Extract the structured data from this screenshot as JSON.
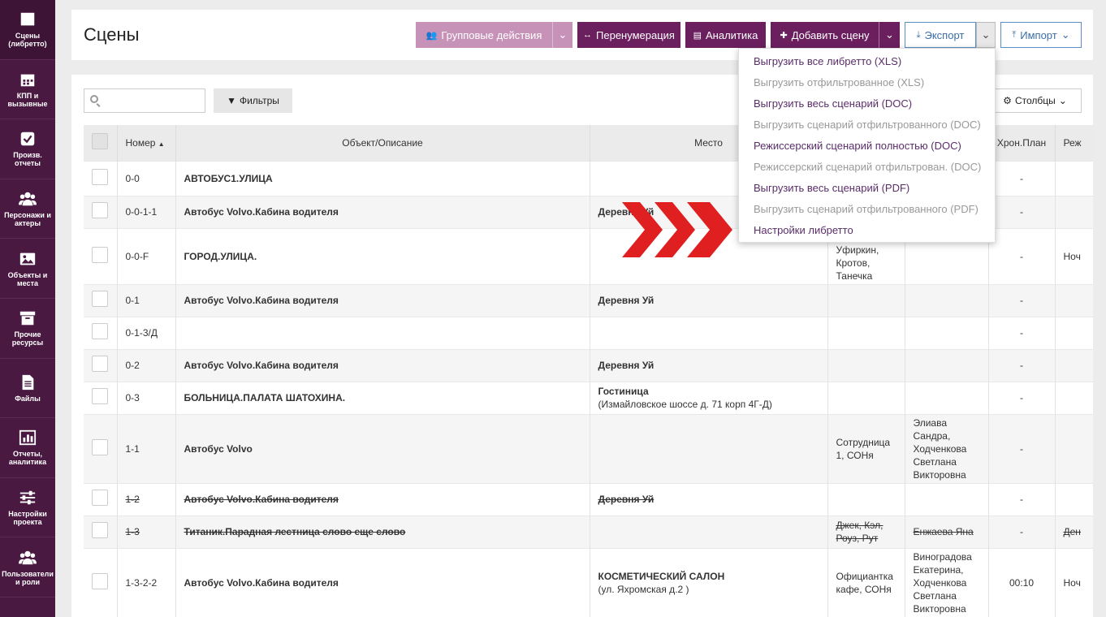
{
  "sidebar": {
    "items": [
      {
        "label": "Сцены (либретто)",
        "icon": "clapperboard-icon"
      },
      {
        "label": "КПП и вызывные",
        "icon": "calendar-icon"
      },
      {
        "label": "Произв. отчеты",
        "icon": "checkbox-icon"
      },
      {
        "label": "Персонажи и актеры",
        "icon": "users-icon"
      },
      {
        "label": "Объекты и места",
        "icon": "image-icon"
      },
      {
        "label": "Прочие ресурсы",
        "icon": "archive-icon"
      },
      {
        "label": "Файлы",
        "icon": "file-icon"
      },
      {
        "label": "Отчеты, аналитика",
        "icon": "bar-chart-icon"
      },
      {
        "label": "Настройки проекта",
        "icon": "sliders-icon"
      },
      {
        "label": "Пользователи и роли",
        "icon": "users-icon"
      }
    ]
  },
  "header": {
    "title": "Сцены",
    "group_actions": "Групповые действия",
    "renumber": "Перенумерация",
    "analytics": "Аналитика",
    "add_scene": "Добавить сцену",
    "export": "Экспорт",
    "import": "Импорт"
  },
  "toolbar": {
    "search_placeholder": "",
    "filters": "Фильтры",
    "columns": "Столбцы"
  },
  "export_menu": [
    {
      "label": "Выгрузить все либретто (XLS)",
      "enabled": true
    },
    {
      "label": "Выгрузить отфильтрованное (XLS)",
      "enabled": false
    },
    {
      "label": "Выгрузить весь сценарий (DOC)",
      "enabled": true
    },
    {
      "label": "Выгрузить сценарий отфильтрованного (DOC)",
      "enabled": false
    },
    {
      "label": "Режиссерский сценарий полностью (DOC)",
      "enabled": true
    },
    {
      "label": "Режиссерский сценарий отфильтрован. (DOC)",
      "enabled": false
    },
    {
      "label": "Выгрузить весь сценарий (PDF)",
      "enabled": true
    },
    {
      "label": "Выгрузить сценарий отфильтрованного (PDF)",
      "enabled": false
    },
    {
      "label": "Настройки либретто",
      "enabled": true
    }
  ],
  "table": {
    "columns": {
      "number": "Номер",
      "object": "Объект/Описание",
      "place": "Место",
      "chron": "Хрон.План",
      "mode": "Реж"
    },
    "rows": [
      {
        "num": "0-0",
        "object": "АВТОБУС1.УЛИЦА",
        "place": "",
        "place_addr": "",
        "c5": "",
        "c6": "",
        "chron": "-",
        "mode": "",
        "strike": false,
        "obj_bold": true
      },
      {
        "num": "0-0-1-1",
        "object": "Автобус Volvo.Кабина водителя",
        "place": "Деревня Уй",
        "place_addr": "",
        "c5": "",
        "c6": "",
        "chron": "-",
        "mode": "",
        "strike": false,
        "obj_bold": true
      },
      {
        "num": "0-0-F",
        "object": "ГОРОД.УЛИЦА.",
        "place": "",
        "place_addr": "",
        "c5": "Рома, Уфиркин, Кротов, Танечка",
        "c6": "",
        "chron": "-",
        "mode": "Ноч",
        "strike": false,
        "obj_bold": true
      },
      {
        "num": "0-1",
        "object": "Автобус Volvo.Кабина водителя",
        "place": "Деревня Уй",
        "place_addr": "",
        "c5": "",
        "c6": "",
        "chron": "-",
        "mode": "",
        "strike": false,
        "obj_bold": true
      },
      {
        "num": "0-1-3/Д",
        "object": "",
        "place": "",
        "place_addr": "",
        "c5": "",
        "c6": "",
        "chron": "-",
        "mode": "",
        "strike": false,
        "obj_bold": true
      },
      {
        "num": "0-2",
        "object": "Автобус Volvo.Кабина водителя",
        "place": "Деревня Уй",
        "place_addr": "",
        "c5": "",
        "c6": "",
        "chron": "-",
        "mode": "",
        "strike": false,
        "obj_bold": true
      },
      {
        "num": "0-3",
        "object": "БОЛЬНИЦА.ПАЛАТА ШАТОХИНА.",
        "place": "Гостиница",
        "place_addr": "(Измайловское шоссе д. 71 корп 4Г-Д)",
        "c5": "",
        "c6": "",
        "chron": "-",
        "mode": "",
        "strike": false,
        "obj_bold": true
      },
      {
        "num": "1-1",
        "object": "Автобус Volvo",
        "place": "",
        "place_addr": "",
        "c5": "Сотрудница 1, СОНя",
        "c6": "Элиава Сандра, Ходченкова Светлана Викторовна",
        "chron": "-",
        "mode": "",
        "strike": false,
        "obj_bold": true
      },
      {
        "num": "1-2",
        "object": "Автобус Volvo.Кабина водителя",
        "place": "Деревня Уй",
        "place_addr": "",
        "c5": "",
        "c6": "",
        "chron": "-",
        "mode": "",
        "strike": true,
        "obj_bold": true
      },
      {
        "num": "1-3",
        "object": "Титаник.Парадная лестница слово еще слово",
        "place": "",
        "place_addr": "",
        "c5": "Джек, Кэл, Роуз, Рут",
        "c6": "Енжаева Яна",
        "chron": "-",
        "mode": "Ден",
        "strike": true,
        "obj_bold": true
      },
      {
        "num": "1-3-2-2",
        "object": "Автобус Volvo.Кабина водителя",
        "place": "КОСМЕТИЧЕСКИЙ САЛОН",
        "place_addr": "(ул. Яхромская д.2 )",
        "c5": "Официантка кафе, СОНя",
        "c6": "Виноградова Екатерина, Ходченкова Светлана Викторовна",
        "chron": "00:10",
        "mode": "Ноч",
        "strike": false,
        "obj_bold": true
      }
    ]
  },
  "colors": {
    "sidebar": "#4a1942",
    "primary": "#6b1f5f",
    "arrows": "#e02020",
    "export_border": "#5b8dc8"
  }
}
